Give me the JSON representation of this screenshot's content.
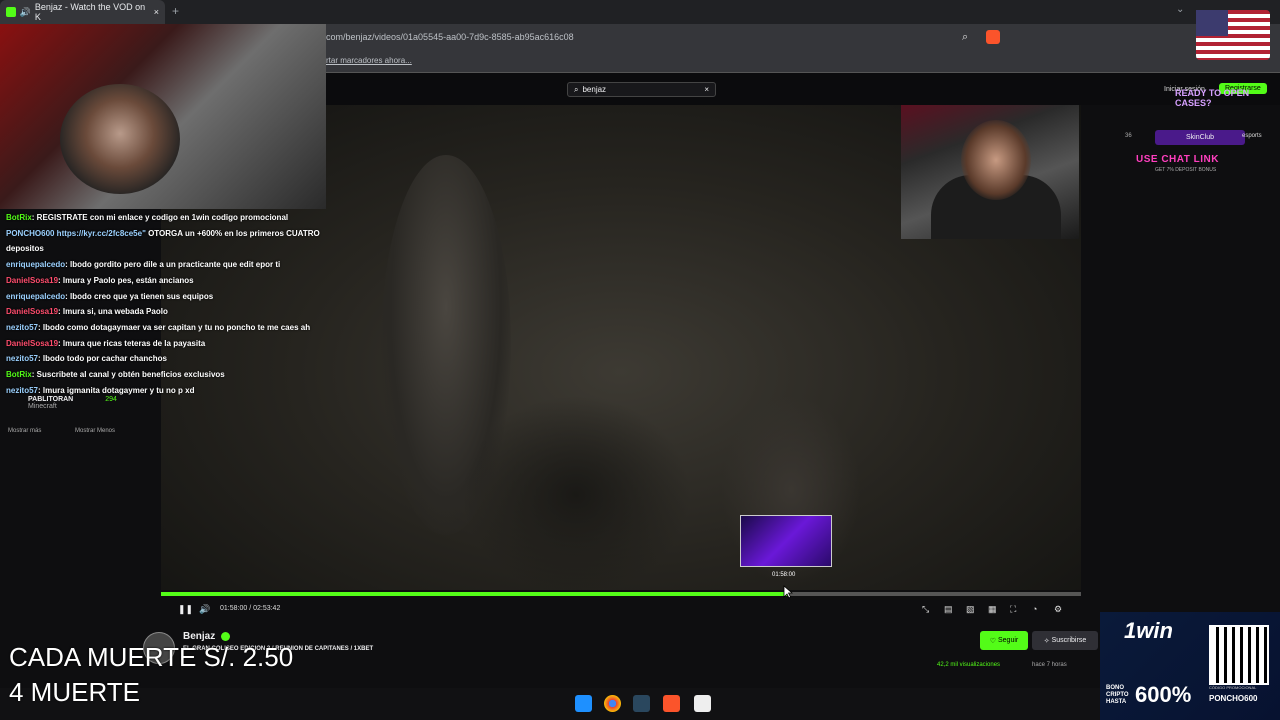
{
  "browser": {
    "tab_title": "Benjaz - Watch the VOD on K",
    "tab_close": "×",
    "new_tab": "+",
    "url": "com/benjaz/videos/01a05545-aa00-7d9c-8585-ab95ac616c08",
    "bookmarks_text": "rtar marcadores ahora..."
  },
  "site": {
    "search_value": "benjaz",
    "search_clear": "×",
    "login": "Iniciar sesión",
    "register": "Registrarse"
  },
  "chat": {
    "lines": [
      {
        "user": "BotRix",
        "message": ": REGISTRATE con mi enlace y codigo en 1win codigo promocional"
      },
      {
        "user": "PONCHO600 https://kyr.cc/2fc8ce5e\"",
        "message": " OTORGA un +600% en los primeros CUATRO"
      },
      {
        "user": "",
        "message": "depositos"
      },
      {
        "user": "enriquepalcedo",
        "message": ": lbodo gordito pero dile a un practicante que edit epor ti"
      },
      {
        "user": "DanielSosa19",
        "message": ": lmura y Paolo pes, están ancianos"
      },
      {
        "user": "enriquepalcedo",
        "message": ": lbodo creo que ya tienen sus equipos"
      },
      {
        "user": "DanielSosa19",
        "message": ": lmura si, una webada Paolo"
      },
      {
        "user": "nezito57",
        "message": ": lbodo como dotagaymaer va ser capitan y tu no poncho te me caes ah"
      },
      {
        "user": "DanielSosa19",
        "message": ": lmura que ricas teteras de la payasita"
      },
      {
        "user": "nezito57",
        "message": ": lbodo todo por cachar chanchos"
      },
      {
        "user": "BotRix",
        "message": ": Suscribete al canal y obtén beneficios exclusivos"
      },
      {
        "user": "nezito57",
        "message": ": lmura igmanita dotagaymer y tu no p xd"
      }
    ],
    "viewer_name": "PABLITORAN",
    "viewer_count": "294",
    "viewer_category": "Minecraft",
    "show_more": "Mostrar más",
    "show_less": "Mostrar Menos"
  },
  "player": {
    "preview_time": "01:58:00",
    "current_time": "01:58:00 / 02:53:42",
    "progress": 0.68
  },
  "stream": {
    "channel": "Benjaz",
    "title": "EL GRAN COLISEO EDICION 2 / REUNION DE CAPITANES / 1XBET",
    "follow": "Seguir",
    "subscribe": "Suscribirse",
    "views": "42,2 mil visualizaciones",
    "ago": "hace 7 horas"
  },
  "promo": {
    "top": "READY TO OPEN CASES?",
    "brand": "SkinClub",
    "cta": "USE CHAT LINK",
    "bonus": "GET 7% DEPOSIT BONUS",
    "side_num": "36",
    "side_text": "esports"
  },
  "overlay": {
    "line1": "CADA MUERTE S/. 2.50",
    "line2": "4 MUERTE"
  },
  "ad": {
    "logo": "1win",
    "bonus_label": "BONO CRIPTO HASTA",
    "bonus_value": "600%",
    "code_label": "CÓDIGO PROMOCIONAL",
    "code": "PONCHO600"
  },
  "colors": {
    "accent": "#53fc18",
    "background": "#0e0e10"
  }
}
